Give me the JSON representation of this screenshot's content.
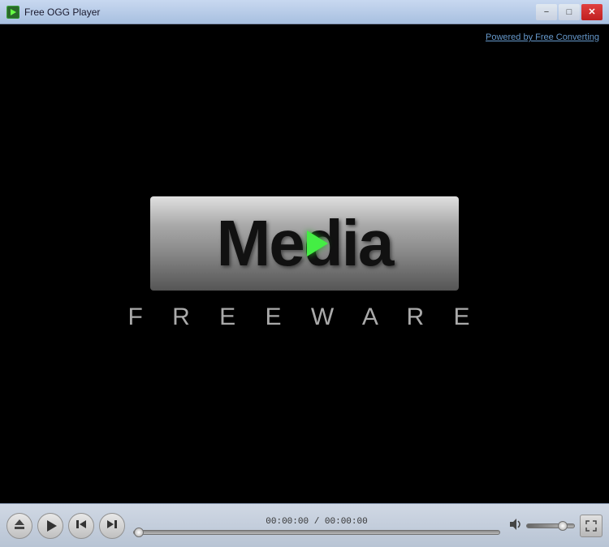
{
  "window": {
    "title": "Free OGG Player",
    "icon_label": "ogg-icon"
  },
  "titlebar": {
    "minimize_label": "−",
    "maximize_label": "□",
    "close_label": "✕"
  },
  "video_area": {
    "powered_by_text": "Powered by Free Converting",
    "media_text_part1": "Me",
    "media_text_d": "d",
    "media_text_part2": "ia",
    "freeware_text": "F r e e w a r e"
  },
  "controls": {
    "time_display": "00:00:00 / 00:00:00",
    "seek_position_pct": 0,
    "volume_pct": 70,
    "eject_label": "Eject",
    "play_label": "Play",
    "prev_label": "Previous",
    "next_label": "Next",
    "volume_label": "Volume",
    "fullscreen_label": "Fullscreen"
  }
}
